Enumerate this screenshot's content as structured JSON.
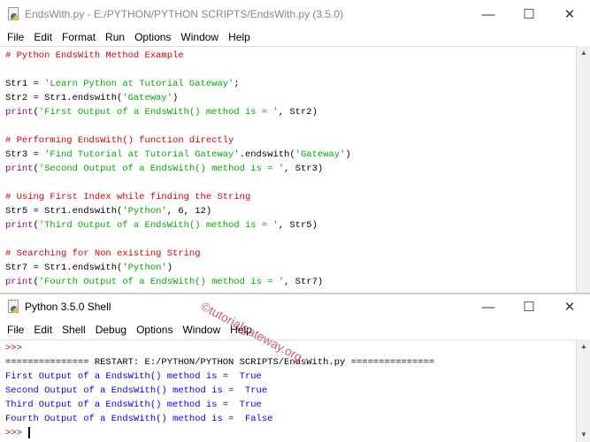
{
  "editor": {
    "title": "EndsWith.py - E:/PYTHON/PYTHON SCRIPTS/EndsWith.py (3.5.0)",
    "menu": [
      "File",
      "Edit",
      "Format",
      "Run",
      "Options",
      "Window",
      "Help"
    ],
    "lines": [
      [
        [
          "# Python EndsWith Method Example",
          "comment"
        ]
      ],
      [],
      [
        [
          "Str1 = ",
          "plain"
        ],
        [
          "'Learn Python at Tutorial Gateway'",
          "string"
        ],
        [
          ";",
          "plain"
        ]
      ],
      [
        [
          "Str2 = Str1.endswith(",
          "plain"
        ],
        [
          "'Gateway'",
          "string"
        ],
        [
          ")",
          "plain"
        ]
      ],
      [
        [
          "print",
          "builtin"
        ],
        [
          "(",
          "plain"
        ],
        [
          "'First Output of a EndsWith() method is = '",
          "string"
        ],
        [
          ", Str2)",
          "plain"
        ]
      ],
      [],
      [
        [
          "# Performing EndsWith() function directly",
          "comment"
        ]
      ],
      [
        [
          "Str3 = ",
          "plain"
        ],
        [
          "'Find Tutorial at Tutorial Gateway'",
          "string"
        ],
        [
          ".endswith(",
          "plain"
        ],
        [
          "'Gateway'",
          "string"
        ],
        [
          ")",
          "plain"
        ]
      ],
      [
        [
          "print",
          "builtin"
        ],
        [
          "(",
          "plain"
        ],
        [
          "'Second Output of a EndsWith() method is = '",
          "string"
        ],
        [
          ", Str3)",
          "plain"
        ]
      ],
      [],
      [
        [
          "# Using First Index while finding the String",
          "comment"
        ]
      ],
      [
        [
          "Str5 = Str1.endswith(",
          "plain"
        ],
        [
          "'Python'",
          "string"
        ],
        [
          ", 6, 12)",
          "plain"
        ]
      ],
      [
        [
          "print",
          "builtin"
        ],
        [
          "(",
          "plain"
        ],
        [
          "'Third Output of a EndsWith() method is = '",
          "string"
        ],
        [
          ", Str5)",
          "plain"
        ]
      ],
      [],
      [
        [
          "# Searching for Non existing String",
          "comment"
        ]
      ],
      [
        [
          "Str7 = Str1.endswith(",
          "plain"
        ],
        [
          "'Python'",
          "string"
        ],
        [
          ")",
          "plain"
        ]
      ],
      [
        [
          "print",
          "builtin"
        ],
        [
          "(",
          "plain"
        ],
        [
          "'Fourth Output of a EndsWith() method is = '",
          "string"
        ],
        [
          ", Str7)",
          "plain"
        ]
      ]
    ]
  },
  "shell": {
    "title": "Python 3.5.0 Shell",
    "menu": [
      "File",
      "Edit",
      "Shell",
      "Debug",
      "Options",
      "Window",
      "Help"
    ],
    "lines": [
      [
        [
          ">>>",
          "prompt"
        ]
      ],
      [
        [
          "=============== RESTART: E:/PYTHON/PYTHON SCRIPTS/EndsWith.py ===============",
          "plain"
        ]
      ],
      [
        [
          "First Output of a EndsWith() method is =  True",
          "out"
        ]
      ],
      [
        [
          "Second Output of a EndsWith() method is =  True",
          "out"
        ]
      ],
      [
        [
          "Third Output of a EndsWith() method is =  True",
          "out"
        ]
      ],
      [
        [
          "Fourth Output of a EndsWith() method is =  False",
          "out"
        ]
      ],
      [
        [
          ">>> ",
          "prompt"
        ]
      ]
    ]
  },
  "controls": {
    "minimize": "—",
    "maximize": "☐",
    "close": "✕"
  },
  "watermark": "©tutorialgateway.org",
  "icons": {
    "scroll_up": "▲",
    "scroll_down": "▼"
  }
}
